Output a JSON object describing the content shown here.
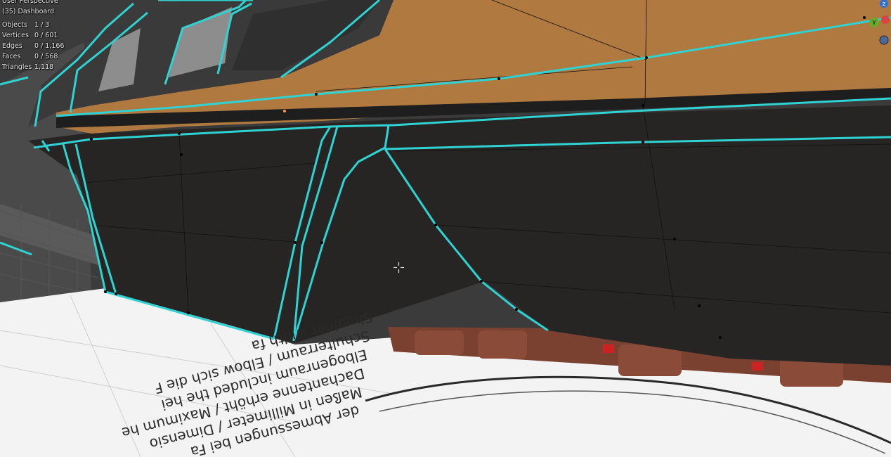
{
  "viewport": {
    "view_name": "User Perspective",
    "collection_object": "(35) Dashboard"
  },
  "stats": [
    {
      "label": "Objects",
      "value": "1 / 3"
    },
    {
      "label": "Vertices",
      "value": "0 / 601"
    },
    {
      "label": "Edges",
      "value": "0 / 1,166"
    },
    {
      "label": "Faces",
      "value": "0 / 568"
    },
    {
      "label": "Triangles",
      "value": "1,118"
    }
  ],
  "gizmo": {
    "axis_y_label": "Y",
    "axis_z_label": "Z"
  },
  "colors": {
    "selection_edge": "#2fd3d3",
    "mesh_dark": "#262523",
    "mesh_orange": "#b07a46",
    "grid_bg": "#3a3a3a",
    "reference_paper": "#f4f4f4",
    "seat_brown": "#6e3a2a"
  },
  "reference_image_text": [
    "der Abmessungen bei Fa",
    "Maßen in Millimeter / Dimensio",
    "Dachantenne erhöht / Maximum he",
    "Elbogenraum included the hei",
    "Schulterraum / Elbow sich die F",
    "Shoulder width fa"
  ]
}
